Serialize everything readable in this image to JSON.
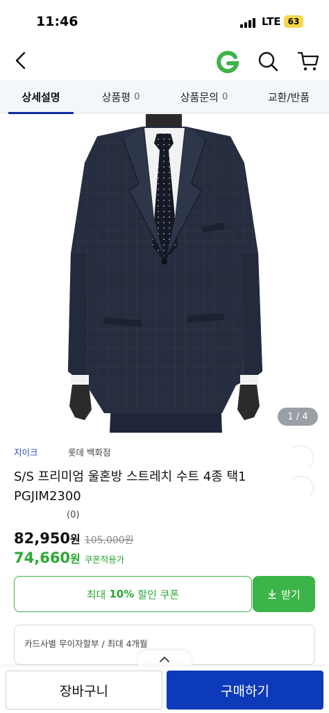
{
  "status_bar": {
    "time": "11:46",
    "network": "LTE",
    "battery": "63"
  },
  "header": {
    "back_icon": "chevron-left-icon",
    "logo_letter": "G",
    "logo_color": "#3db449",
    "search_icon": "search-icon",
    "cart_icon": "cart-icon"
  },
  "tabs": [
    {
      "label": "상세설명",
      "count": "",
      "active": true
    },
    {
      "label": "상품평",
      "count": "0",
      "active": false
    },
    {
      "label": "상품문의",
      "count": "0",
      "active": false
    },
    {
      "label": "교환/반품",
      "count": "",
      "active": false
    }
  ],
  "image": {
    "counter": "1 / 4"
  },
  "product": {
    "seller": "지이크",
    "store": "롯데 백화점",
    "title": "S/S 프리미엄 울혼방 스트레치 수트 4종 택1 PGJIM2300",
    "review_count": "(0)",
    "price": "82,950",
    "price_unit": "원",
    "original_price": "105,000원",
    "coupon_price": "74,660",
    "coupon_unit": "원",
    "coupon_note": "쿠폰적용가"
  },
  "coupon": {
    "prefix": "최대",
    "percent": "10%",
    "suffix": "할인 쿠폰",
    "receive_label": "받기",
    "accent_color": "#3db449"
  },
  "card_info": "카드사별 무이자할부 / 최대 4개월",
  "bottom": {
    "cart_label": "장바구니",
    "buy_label": "구매하기",
    "buy_color": "#0d3ab8"
  }
}
